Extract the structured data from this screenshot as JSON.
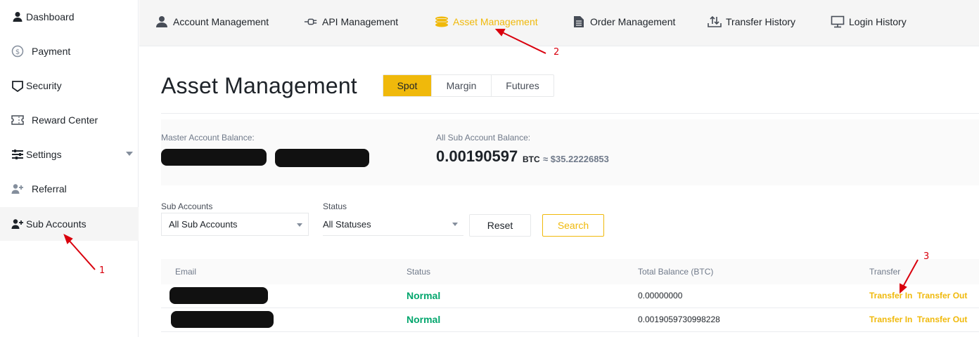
{
  "sidebar": {
    "items": [
      {
        "label": "Dashboard",
        "icon": "user-icon"
      },
      {
        "label": "Payment",
        "icon": "dollar-circle-icon"
      },
      {
        "label": "Security",
        "icon": "shield-icon"
      },
      {
        "label": "Reward Center",
        "icon": "ticket-icon"
      },
      {
        "label": "Settings",
        "icon": "sliders-icon"
      },
      {
        "label": "Referral",
        "icon": "user-plus-icon"
      },
      {
        "label": "Sub Accounts",
        "icon": "user-plus-icon",
        "active": true
      }
    ]
  },
  "topnav": {
    "tabs": [
      {
        "label": "Account Management",
        "icon": "user-icon"
      },
      {
        "label": "API Management",
        "icon": "plug-icon"
      },
      {
        "label": "Asset Management",
        "icon": "coins-icon",
        "active": true
      },
      {
        "label": "Order Management",
        "icon": "document-icon"
      },
      {
        "label": "Transfer History",
        "icon": "transfer-icon"
      },
      {
        "label": "Login History",
        "icon": "monitor-icon"
      }
    ]
  },
  "main": {
    "title": "Asset Management",
    "segments": [
      "Spot",
      "Margin",
      "Futures"
    ],
    "active_segment": "Spot",
    "balances": {
      "master_label": "Master Account Balance:",
      "sub_label": "All Sub Account Balance:",
      "sub_value": "0.00190597",
      "sub_unit": "BTC",
      "sub_usd": "≈ $35.22226853"
    },
    "filters": {
      "sub_accounts_label": "Sub Accounts",
      "sub_accounts_value": "All Sub Accounts",
      "status_label": "Status",
      "status_value": "All Statuses",
      "reset_label": "Reset",
      "search_label": "Search"
    },
    "table": {
      "headers": [
        "Email",
        "Status",
        "Total Balance (BTC)",
        "Transfer"
      ],
      "rows": [
        {
          "status": "Normal",
          "balance": "0.00000000",
          "transfer_in": "Transfer In",
          "transfer_out": "Transfer Out"
        },
        {
          "status": "Normal",
          "balance": "0.0019059730998228",
          "transfer_in": "Transfer In",
          "transfer_out": "Transfer Out"
        }
      ]
    }
  },
  "annotations": {
    "one": "1",
    "two": "2",
    "three": "3"
  },
  "colors": {
    "accent": "#f0b90b",
    "success": "#03a66d",
    "annotation": "#d9000d"
  }
}
